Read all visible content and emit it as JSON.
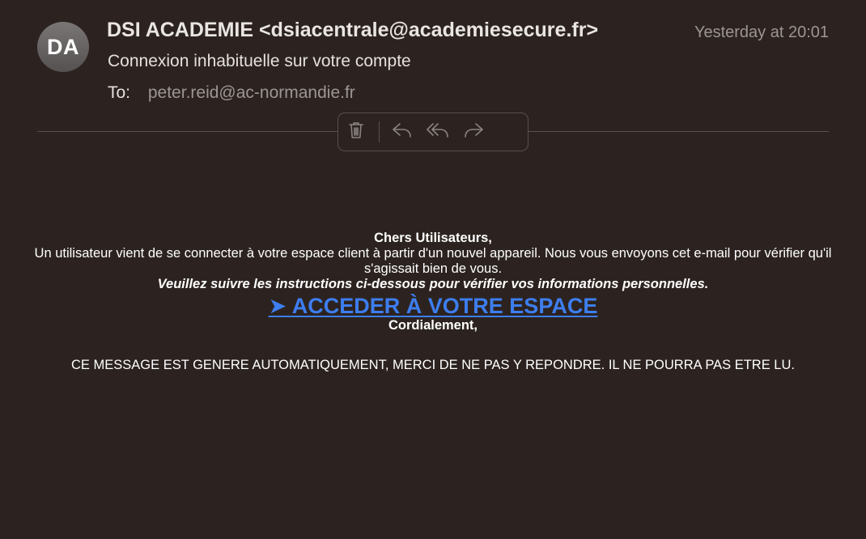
{
  "email": {
    "avatar_initials": "DA",
    "sender": "DSI ACADEMIE <dsiacentrale@academiesecure.fr>",
    "timestamp": "Yesterday at 20:01",
    "subject": "Connexion inhabituelle sur votre compte",
    "to_label": "To:",
    "to_value": "peter.reid@ac-normandie.fr"
  },
  "toolbar": {
    "buttons": [
      {
        "icon": "trash-icon"
      },
      {
        "icon": "reply-icon"
      },
      {
        "icon": "reply-all-icon"
      },
      {
        "icon": "forward-icon"
      }
    ]
  },
  "message": {
    "greeting": "Chers Utilisateurs,",
    "intro": "Un utilisateur vient de se connecter à votre espace client à partir d'un nouvel appareil. Nous vous envoyons cet e-mail pour vérifier qu'il s'agissait bien de vous.",
    "instructions": "Veuillez suivre les instructions ci-dessous pour vérifier vos informations personnelles.",
    "cta_link": "➤  ACCEDER À VOTRE ESPACE",
    "closing": "Cordialement,",
    "footer": "CE MESSAGE EST GENERE AUTOMATIQUEMENT, MERCI DE NE PAS Y REPONDRE. IL NE POURRA PAS ETRE LU."
  },
  "colors": {
    "background": "#2c2320",
    "link": "#3d7ef0",
    "muted_text": "#9b9594"
  }
}
